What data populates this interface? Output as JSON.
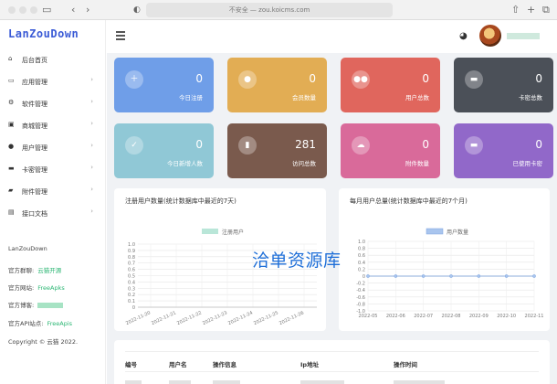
{
  "browser": {
    "address": "不安全 — zou.koicms.com",
    "sidebar_icon": "sidebar-toggle-icon",
    "share_icon": "share-icon",
    "new_tab_icon": "plus-icon",
    "tabs_icon": "tabs-icon"
  },
  "brand": {
    "logo": "LanZouDown",
    "color": "#3b5bd6"
  },
  "sidebar": {
    "items": [
      {
        "label": "后台首页",
        "icon": "home-icon",
        "arrow": ""
      },
      {
        "label": "应用管理",
        "icon": "laptop-icon",
        "arrow": "›"
      },
      {
        "label": "软件管理",
        "icon": "gear-icon",
        "arrow": "›"
      },
      {
        "label": "商城管理",
        "icon": "store-icon",
        "arrow": "›"
      },
      {
        "label": "用户管理",
        "icon": "user-icon",
        "arrow": "›"
      },
      {
        "label": "卡密管理",
        "icon": "card-icon",
        "arrow": "›"
      },
      {
        "label": "附件管理",
        "icon": "folder-icon",
        "arrow": "›"
      },
      {
        "label": "接口文档",
        "icon": "doc-icon",
        "arrow": "›"
      }
    ],
    "footer": {
      "name": "LanZouDown",
      "group_label": "官方群聊:",
      "group_value": "云猫开源",
      "site_label": "官方网站:",
      "site_value": "FreeApks",
      "blog_label": "官方博客:",
      "api_label": "官方API站点:",
      "api_value": "FreeApis",
      "copyright": "Copyright © 云猫 2022."
    }
  },
  "header": {
    "menu_icon": "hamburger-icon",
    "theme_icon": "palette-icon"
  },
  "stats": [
    {
      "value": "0",
      "label": "今日注册",
      "color": "#6f9ee8",
      "icon": "user-plus-icon"
    },
    {
      "value": "0",
      "label": "会员数量",
      "color": "#e2ad54",
      "icon": "user-icon"
    },
    {
      "value": "0",
      "label": "用户总数",
      "color": "#e0665d",
      "icon": "users-icon"
    },
    {
      "value": "0",
      "label": "卡密总数",
      "color": "#4b5058",
      "icon": "card-icon"
    },
    {
      "value": "0",
      "label": "今日新增人数",
      "color": "#90c8d6",
      "icon": "user-check-icon"
    },
    {
      "value": "281",
      "label": "访问总数",
      "color": "#7a5a4d",
      "icon": "bar-chart-icon"
    },
    {
      "value": "0",
      "label": "附件数量",
      "color": "#d96a9a",
      "icon": "cloud-upload-icon"
    },
    {
      "value": "0",
      "label": "已使用卡密",
      "color": "#9168c9",
      "icon": "card-icon"
    }
  ],
  "charts": {
    "left_title": "注册用户数量(统计数据库中最近的7天)",
    "right_title": "每月用户总量(统计数据库中最近的7个月)"
  },
  "chart_data": [
    {
      "type": "bar",
      "title": "注册用户数量(统计数据库中最近的7天)",
      "categories": [
        "2022-11-20",
        "2022-11-21",
        "2022-11-22",
        "2022-11-23",
        "2022-11-24",
        "2022-11-25",
        "2022-11-26"
      ],
      "series": [
        {
          "name": "注册用户",
          "values": [
            0,
            0,
            0,
            0,
            0,
            0,
            0
          ],
          "color": "#b9e6d8"
        }
      ],
      "yticks": [
        "0",
        "0.1",
        "0.2",
        "0.3",
        "0.4",
        "0.5",
        "0.6",
        "0.7",
        "0.8",
        "0.9",
        "1.0"
      ],
      "ylim": [
        0,
        1.0
      ],
      "grid": true,
      "legend": "top"
    },
    {
      "type": "line",
      "title": "每月用户总量(统计数据库中最近的7个月)",
      "categories": [
        "2022-05",
        "2022-06",
        "2022-07",
        "2022-08",
        "2022-09",
        "2022-10",
        "2022-11"
      ],
      "series": [
        {
          "name": "用户数量",
          "values": [
            0,
            0,
            0,
            0,
            0,
            0,
            0
          ],
          "color": "#a9c5ee"
        }
      ],
      "yticks": [
        "-1.0",
        "-0.8",
        "-0.6",
        "-0.4",
        "-0.2",
        "0",
        "0.2",
        "0.4",
        "0.6",
        "0.8",
        "1.0"
      ],
      "ylim": [
        -1.0,
        1.0
      ],
      "grid": true,
      "legend": "top"
    }
  ],
  "watermark": "洽单资源库",
  "table": {
    "headers": [
      "编号",
      "用户名",
      "操作信息",
      "Ip地址",
      "操作时间"
    ]
  }
}
